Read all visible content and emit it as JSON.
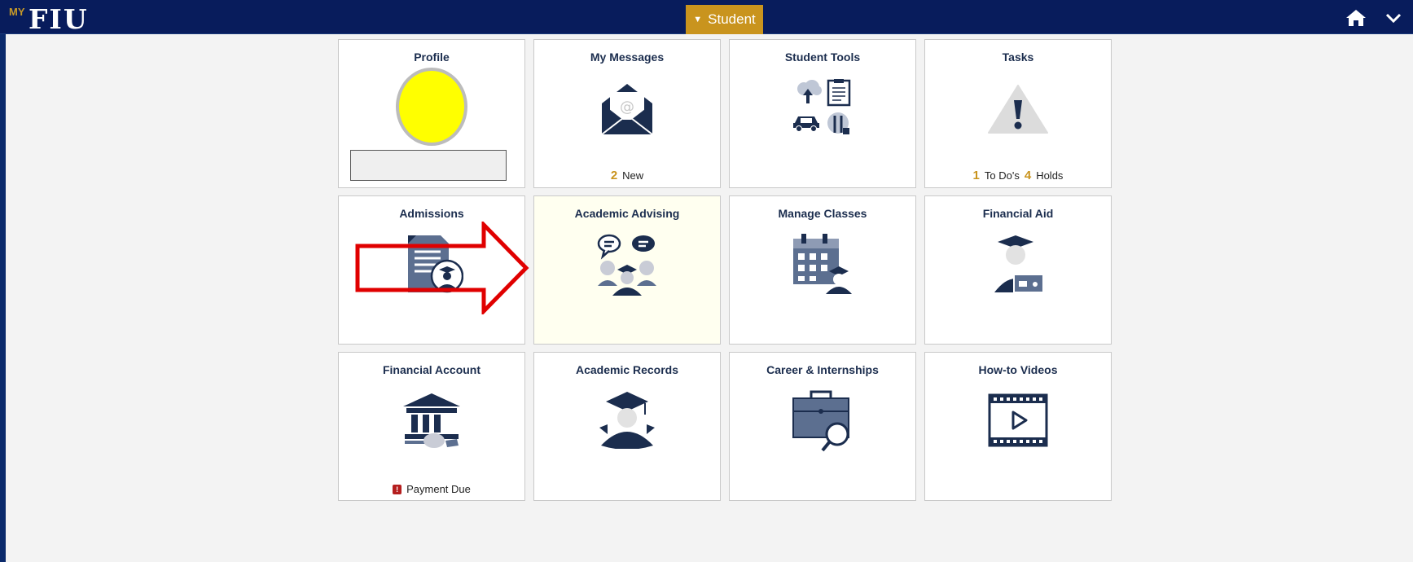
{
  "header": {
    "logo_my": "MY",
    "logo_fiu": "FIU",
    "role_label": "Student",
    "home_icon": "home-icon",
    "menu_icon": "chevron-down-icon"
  },
  "tiles": [
    {
      "title": "Profile"
    },
    {
      "title": "My Messages",
      "count": "2",
      "count_label": "New"
    },
    {
      "title": "Student Tools"
    },
    {
      "title": "Tasks",
      "todo_count": "1",
      "todo_label": "To Do's",
      "hold_count": "4",
      "hold_label": "Holds"
    },
    {
      "title": "Admissions"
    },
    {
      "title": "Academic Advising"
    },
    {
      "title": "Manage Classes"
    },
    {
      "title": "Financial Aid"
    },
    {
      "title": "Financial Account",
      "status_label": "Payment Due"
    },
    {
      "title": "Academic Records"
    },
    {
      "title": "Career & Internships"
    },
    {
      "title": "How-to Videos"
    }
  ],
  "colors": {
    "header_bg": "#081c5c",
    "accent_gold": "#c9941e",
    "icon_navy": "#1b2d4e",
    "highlight_tile": "#fffff0",
    "annotation_red": "#e00000"
  }
}
